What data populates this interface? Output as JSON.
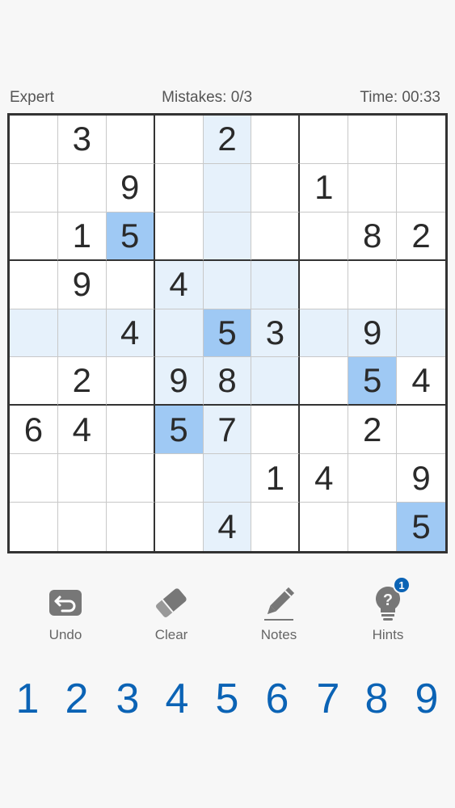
{
  "header": {
    "difficulty": "Expert",
    "mistakes": "Mistakes: 0/3",
    "timer": "Time: 00:33"
  },
  "board": {
    "cells": [
      [
        "",
        "3",
        "",
        "",
        "2",
        "",
        "",
        "",
        ""
      ],
      [
        "",
        "",
        "9",
        "",
        "",
        "",
        "1",
        "",
        ""
      ],
      [
        "",
        "1",
        "5",
        "",
        "",
        "",
        "",
        "8",
        "2"
      ],
      [
        "",
        "9",
        "",
        "4",
        "",
        "",
        "",
        "",
        ""
      ],
      [
        "",
        "",
        "4",
        "",
        "5",
        "3",
        "",
        "9",
        ""
      ],
      [
        "",
        "2",
        "",
        "9",
        "8",
        "",
        "",
        "5",
        "4"
      ],
      [
        "6",
        "4",
        "",
        "5",
        "7",
        "",
        "",
        "2",
        ""
      ],
      [
        "",
        "",
        "",
        "",
        "",
        "1",
        "4",
        "",
        "9"
      ],
      [
        "",
        "",
        "",
        "",
        "4",
        "",
        "",
        "",
        "5"
      ]
    ],
    "selected_cell": [
      4,
      4
    ],
    "matching_value": "5"
  },
  "tools": {
    "undo": {
      "label": "Undo",
      "icon": "undo-icon"
    },
    "clear": {
      "label": "Clear",
      "icon": "eraser-icon"
    },
    "notes": {
      "label": "Notes",
      "icon": "pencil-icon"
    },
    "hints": {
      "label": "Hints",
      "icon": "lightbulb-icon",
      "count": "1"
    }
  },
  "numpad": [
    "1",
    "2",
    "3",
    "4",
    "5",
    "6",
    "7",
    "8",
    "9"
  ],
  "colors": {
    "accent": "#0b63b5",
    "highlight": "#e6f1fb",
    "selected": "#9fc9f4"
  }
}
